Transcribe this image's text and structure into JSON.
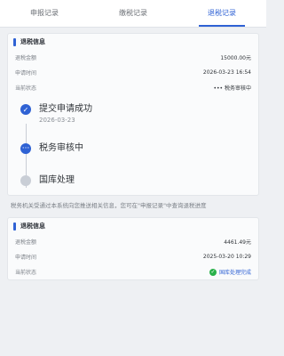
{
  "tabs": [
    {
      "label": "申报记录"
    },
    {
      "label": "缴税记录"
    },
    {
      "label": "退税记录"
    }
  ],
  "card1": {
    "title": "退税信息",
    "rows": [
      {
        "key": "退税金额",
        "value": "15000.00元"
      },
      {
        "key": "申请时间",
        "value": "2026-03-23 16:54"
      },
      {
        "key": "当前状态",
        "value": "••• 税务审核中"
      }
    ],
    "steps": [
      {
        "title": "提交申请成功",
        "date": "2026-03-23"
      },
      {
        "title": "税务审核中"
      },
      {
        "title": "国库处理"
      }
    ]
  },
  "notice": "税务机关受通过本系统向您推送相关信息，您可在\"申报记录\"中查询退税进度",
  "card2": {
    "title": "退税信息",
    "rows": [
      {
        "key": "退税金额",
        "value": "4461.49元"
      },
      {
        "key": "申请时间",
        "value": "2025-03-20 10:29"
      },
      {
        "key": "当前状态",
        "value": "国库处理完成"
      }
    ]
  },
  "icons": {
    "done": "check-icon",
    "current": "ellipsis-icon",
    "pending": "pending-icon",
    "complete": "check-circle-icon"
  },
  "colors": {
    "accent": "#2f62d4",
    "success": "#29b14a"
  }
}
